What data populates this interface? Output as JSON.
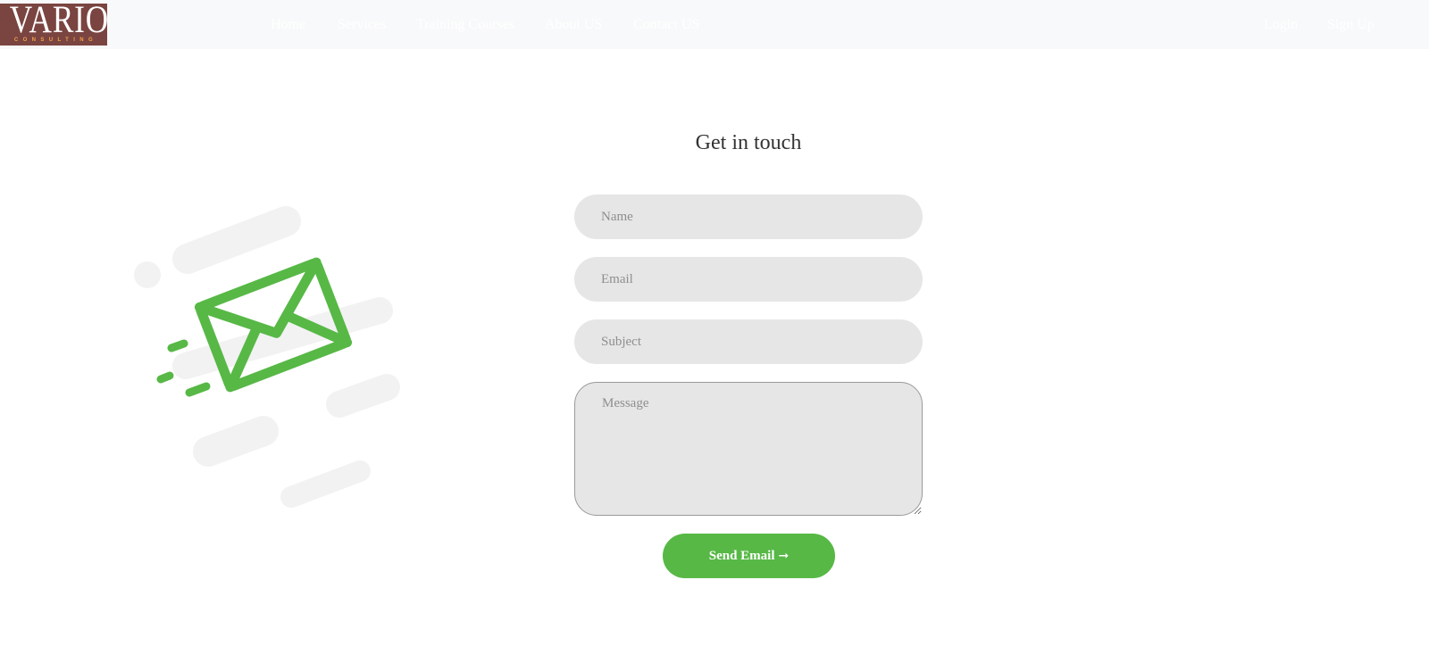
{
  "navbar": {
    "logo": {
      "word": "VARIO",
      "subtitle": "CONSULTING"
    },
    "links": {
      "home": "Home",
      "services": "Services",
      "training": "Training Courses",
      "about": "About US",
      "contact": "Contact US"
    },
    "auth": {
      "login": "Login",
      "signup": "Sign Up"
    }
  },
  "illustration": {
    "icon": "envelope-icon",
    "accent_color": "#57b846",
    "stripe_color": "#f2f2f2"
  },
  "contact_form": {
    "title": "Get in touch",
    "name_placeholder": "Name",
    "email_placeholder": "Email",
    "subject_placeholder": "Subject",
    "message_placeholder": "Message",
    "submit_label": "Send Email",
    "submit_icon": "arrow-right-icon",
    "submit_color": "#57b846",
    "field_background": "#e6e6e6"
  }
}
